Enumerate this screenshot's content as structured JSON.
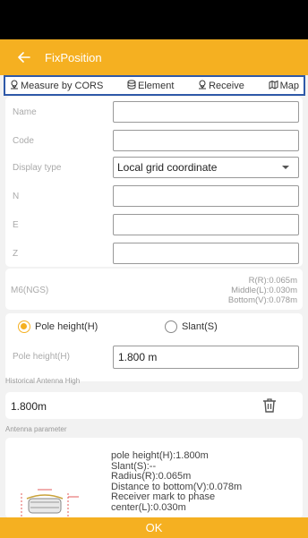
{
  "appbar": {
    "title": "FixPosition",
    "back_icon": "arrow-left-icon"
  },
  "tabs": [
    {
      "label": "Measure by CORS",
      "icon": "location-pin-icon"
    },
    {
      "label": "Element",
      "icon": "database-icon"
    },
    {
      "label": "Receive",
      "icon": "location-pin-icon"
    },
    {
      "label": "Map",
      "icon": "map-icon"
    }
  ],
  "form": {
    "name_label": "Name",
    "name_value": "",
    "code_label": "Code",
    "code_value": "",
    "display_type_label": "Display type",
    "display_type_value": "Local grid coordinate",
    "n_label": "N",
    "n_value": "",
    "e_label": "E",
    "e_value": "",
    "z_label": "Z",
    "z_value": ""
  },
  "antenna_model": {
    "name": "M6(NGS)",
    "r": "R(R):0.065m",
    "middle": "Middle(L):0.030m",
    "bottom": "Bottom(V):0.078m"
  },
  "height": {
    "pole_option": "Pole height(H)",
    "slant_option": "Slant(S)",
    "selected": "Pole height(H)",
    "pole_label": "Pole height(H)",
    "pole_value": "1.800 m"
  },
  "history": {
    "label": "Historical Antenna High",
    "value": "1.800m",
    "delete_icon": "trash-icon"
  },
  "antenna_param": {
    "label": "Antenna parameter",
    "line1": "pole height(H):1.800m",
    "line2": "Slant(S):--",
    "line3": "Radius(R):0.065m",
    "line4": "Distance to bottom(V):0.078m",
    "line5": "Receiver mark to phase",
    "line6": "center(L):0.030m"
  },
  "footer": {
    "ok_label": "OK"
  },
  "colors": {
    "accent": "#f5b021",
    "tab_border": "#2f59a8",
    "status_bar": "#000000"
  }
}
